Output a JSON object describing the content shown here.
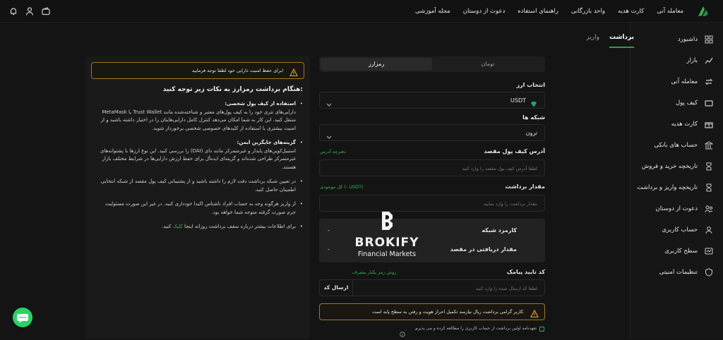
{
  "topbar": {
    "nav": [
      "معامله آنی",
      "کارت هدیه",
      "واحد بازرگانی",
      "راهنمای استفاده",
      "دعوت از دوستان",
      "مجله آموزشی"
    ],
    "icons": [
      "bell-icon",
      "user-icon",
      "wallet-icon"
    ]
  },
  "sidebar": {
    "items": [
      {
        "label": "داشبورد",
        "icon": "dashboard-icon"
      },
      {
        "label": "بازار",
        "icon": "market-icon"
      },
      {
        "label": "معامله آنی",
        "icon": "instant-trade-icon"
      },
      {
        "label": "کیف پول",
        "icon": "wallet-icon"
      },
      {
        "label": "کارت هدیه",
        "icon": "gift-card-icon"
      },
      {
        "label": "حساب های بانکی",
        "icon": "bank-icon"
      },
      {
        "label": "تاریخچه خرید و فروش",
        "icon": "history-icon"
      },
      {
        "label": "تاریخچه واریز و برداشت",
        "icon": "history-icon"
      },
      {
        "label": "دعوت از دوستان",
        "icon": "invite-icon"
      },
      {
        "label": "حساب کاربری",
        "icon": "user-icon"
      },
      {
        "label": "سطح کاربری",
        "icon": "level-icon"
      },
      {
        "label": "تنظیمات امنیتی",
        "icon": "security-icon"
      }
    ]
  },
  "tabs": {
    "active": "برداشت",
    "other": "واریز"
  },
  "segment": {
    "toman": "تومان",
    "crypto": "رمزارز"
  },
  "form": {
    "currency_label": "انتخاب ارز",
    "currency_value": "USDT",
    "network_label": "شبکه ها",
    "network_value": "ترون",
    "address_label": "آدرس کیف پول مقصد",
    "address_link": "دفترچه آدرس",
    "address_placeholder": "لطفا آدرس کیف پول مقصد را وارد کنید",
    "amount_label": "مقدار برداشت",
    "amount_balance": "کل موجودی (- USDT)",
    "amount_placeholder": "مقدار برداشت را وارد نمایید",
    "fee_label": "کارمزد شبکه",
    "fee_value": "-",
    "receive_label": "مقدار دریافتی در مقصد",
    "receive_value": "-",
    "sms_label": "کد تایید پیامک",
    "sms_link": "روش رمز یکبار مصرف",
    "sms_placeholder": "لطفا کد ارسال شده را وارد کنید",
    "send_code": "ارسال کد",
    "notice": "کاربر گرامی برداشت ریال نیازمند تکمیل احراز هویت و رفتن به سطح پایه است.",
    "agree": "تعهدنامه اولین برداشت از حساب کاربری را مطالعه کرده و می پذیرم"
  },
  "brand": {
    "name": "BROKIFY",
    "sub": "Financial Markets"
  },
  "panel": {
    "warning": "برای حفظ امنیت دارایی خود لطفا توجه فرمایید!",
    "title": "هنگام برداشت رمزارز به نکات زیر توجه کنید:",
    "items": [
      {
        "head": "استفاده از کیف پول شخصی:",
        "body": "دارایی‌های تتری خود را به کیف پول‌های معتبر و شناخته‌شده مانند Trust Wallet یا MetaMask منتقل کنید. این کار به شما امکان می‌دهد کنترل کامل دارایی‌هایتان را در اختیار داشته باشید و از امنیت بیشتری با استفاده از کلیدهای خصوصی شخصی برخوردار شوید."
      },
      {
        "head": "گزینه‌های جایگزین ایمن:",
        "body": "استیبل‌کوین‌های پایدار و غیرمتمرکز مانند دای (DAI) را بررسی کنید. این نوع ارزها با پشتوانه‌های غیرمتمرکز طراحی شده‌اند و گزینه‌ای ایده‌آل برای حفظ ارزش دارایی‌ها در شرایط مختلف بازار هستند."
      },
      {
        "head": "",
        "body": "در تعیین شبکه برداشت دقت لازم را داشته باشید و از پشتیبانی کیف پول مقصد از شبکه انتخابی اطمینان حاصل کنید."
      },
      {
        "head": "",
        "body": "از واریز هرگونه وجه به حساب افراد ناشناس اکیدا خودداری کنید. در غیر این صورت مسئولیت جرم صورت گرفته متوجه شما خواهد بود."
      },
      {
        "head": "",
        "body": "برای اطلاعات بیشتر درباره سقف برداشت روزانه اینجا",
        "link": "کلیک",
        "tail": "کنید."
      }
    ]
  },
  "colors": {
    "accent": "#37b24d",
    "warning": "#a07a1a",
    "bg": "#141414"
  }
}
